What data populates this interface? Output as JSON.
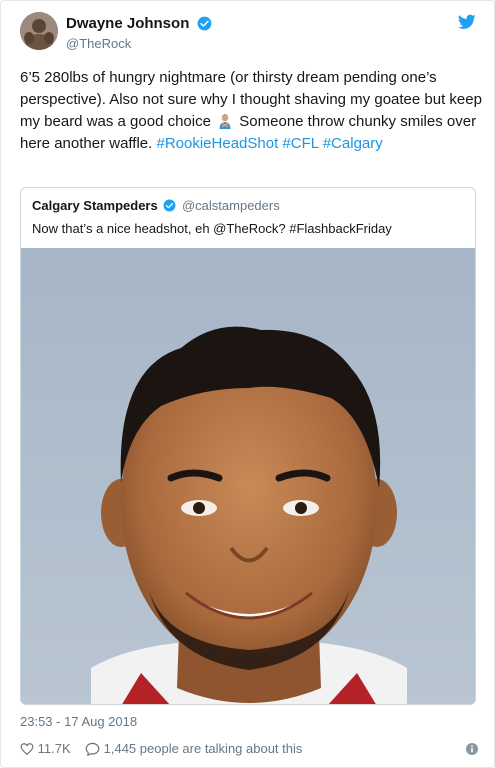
{
  "author": {
    "display_name": "Dwayne Johnson",
    "handle": "@TheRock"
  },
  "tweet": {
    "text_part1": "6’5 280lbs of hungry nightmare (or thirsty dream pending one’s perspective). Also not sure why I thought shaving my goatee but keep my beard was a good choice",
    "text_part2": "Someone throw chunky smiles over here another waffle.",
    "hashtag1": "#RookieHeadShot",
    "hashtag2": "#CFL",
    "hashtag3": "#Calgary"
  },
  "quoted": {
    "display_name": "Calgary Stampeders",
    "handle": "@calstampeders",
    "text": "Now that’s a nice headshot, eh @TheRock? #FlashbackFriday"
  },
  "meta": {
    "timestamp": "23:53 - 17 Aug 2018",
    "likes": "11.7K",
    "talking": "1,445 people are talking about this"
  },
  "colors": {
    "link": "#1b95e0",
    "verified": "#1da1f2",
    "secondary": "#657786"
  }
}
